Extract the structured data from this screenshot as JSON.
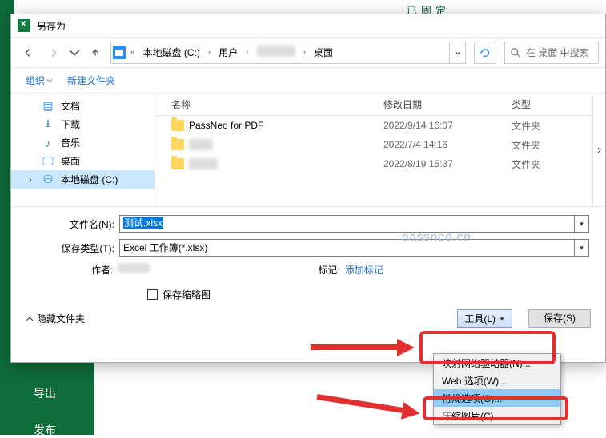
{
  "background": {
    "pinned_label": "已固定",
    "export_label": "导出",
    "publish_label": "发布"
  },
  "dialog": {
    "title": "另存为",
    "breadcrumbs": {
      "drive": "本地磁盘 (C:)",
      "users": "用户",
      "desktop": "桌面"
    },
    "search_placeholder": "在 桌面 中搜索",
    "toolbar": {
      "organize": "组织",
      "new_folder": "新建文件夹"
    },
    "sidebar": {
      "items": [
        {
          "label": "文档",
          "icon": "📄"
        },
        {
          "label": "下载",
          "icon": "↓"
        },
        {
          "label": "音乐",
          "icon": "♪"
        },
        {
          "label": "桌面",
          "icon": "🖥"
        },
        {
          "label": "本地磁盘 (C:)",
          "icon": "💾"
        }
      ]
    },
    "columns": {
      "name": "名称",
      "date": "修改日期",
      "type": "类型"
    },
    "files": [
      {
        "name": "PassNeo for PDF",
        "date": "2022/9/14 16:07",
        "type": "文件夹"
      },
      {
        "name": "",
        "date": "2022/7/4 14:16",
        "type": "文件夹"
      },
      {
        "name": "",
        "date": "2022/8/19 15:37",
        "type": "文件夹"
      }
    ],
    "form": {
      "filename_label": "文件名(N):",
      "filename_value": "测试.xlsx",
      "filetype_label": "保存类型(T):",
      "filetype_value": "Excel 工作簿(*.xlsx)",
      "author_label": "作者:",
      "tags_label": "标记:",
      "tags_value": "添加标记",
      "thumb_label": "保存缩略图"
    },
    "footer": {
      "hide_folders": "隐藏文件夹",
      "tools": "工具(L)",
      "save": "保存(S)"
    }
  },
  "menu": {
    "items": [
      "映射网络驱动器(N)...",
      "Web 选项(W)...",
      "常规选项(G)...",
      "压缩图片(C)..."
    ]
  },
  "watermark": "passneo.cn"
}
